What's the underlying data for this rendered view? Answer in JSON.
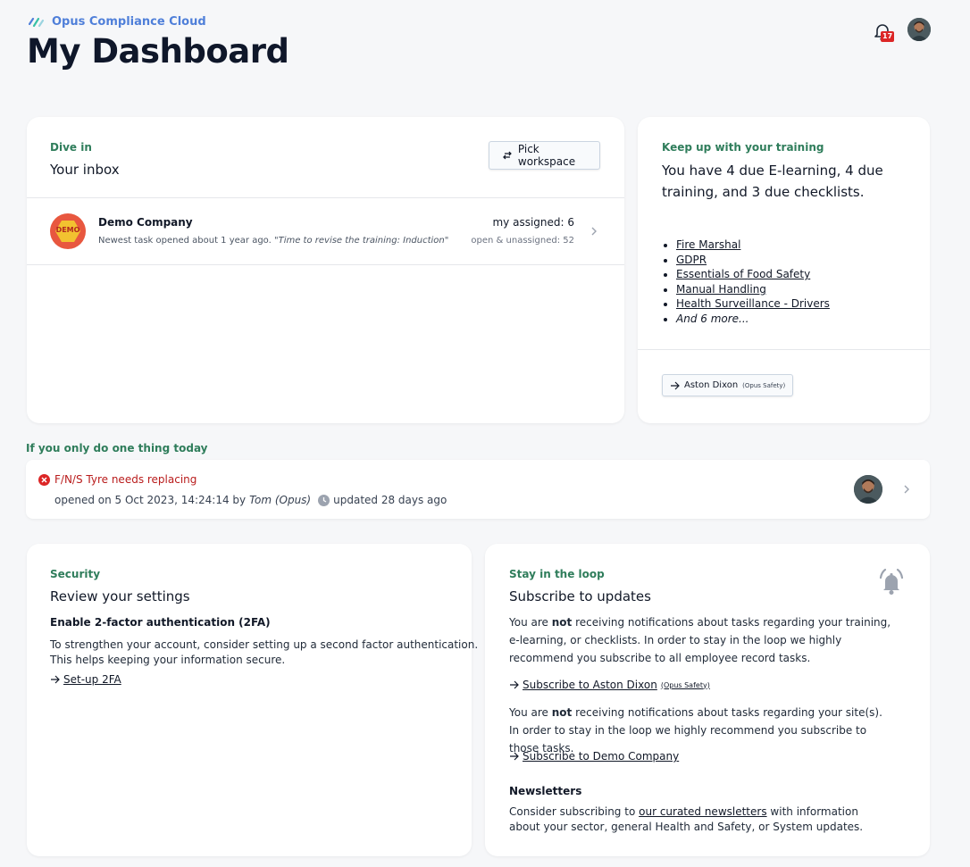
{
  "header": {
    "brand": "Opus Compliance Cloud",
    "title": "My Dashboard",
    "notification_count": "17"
  },
  "inbox": {
    "eyebrow": "Dive in",
    "title": "Your inbox",
    "pick_workspace_label": "Pick workspace",
    "company": {
      "logo_text": "DEMO",
      "name": "Demo Company",
      "newest": "Newest task opened about 1 year ago.",
      "quote": "\"Time to revise the training: Induction\"",
      "my_assigned": "my assigned: 6",
      "open_unassigned": "open & unassigned: 52"
    }
  },
  "training": {
    "eyebrow": "Keep up with your training",
    "title": "You have 4 due E-learning, 4 due training, and 3 due checklists.",
    "items": [
      "Fire Marshal",
      "GDPR",
      "Essentials of Food Safety",
      "Manual Handling",
      "Health Surveillance - Drivers"
    ],
    "more": "And 6 more...",
    "person_name": "Aston Dixon",
    "person_org": "(Opus Safety)"
  },
  "one_thing": {
    "eyebrow": "If you only do one thing today",
    "task_title": "F/N/S Tyre needs replacing",
    "opened_prefix": "opened on 5 Oct 2023, 14:24:14 by",
    "opened_by": "Tom (Opus)",
    "updated": "updated 28 days ago"
  },
  "security": {
    "eyebrow": "Security",
    "title": "Review your settings",
    "subheading": "Enable 2-factor authentication (2FA)",
    "desc_line1": "To strengthen your account, consider setting up a second factor authentication.",
    "desc_line2": "This helps keeping your information secure.",
    "setup_link": "Set-up 2FA"
  },
  "loop": {
    "eyebrow": "Stay in the loop",
    "title": "Subscribe to updates",
    "you_are": "You are",
    "not": "not",
    "p1_rest": "receiving notifications about tasks regarding your training, e-learning, or checklists. In order to stay in the loop we highly recommend you subscribe to all employee record tasks.",
    "sub1_label": "Subscribe to Aston Dixon",
    "sub1_org": "(Opus Safety)",
    "p2_rest": "receiving notifications about tasks regarding your site(s). In order to stay in the loop we highly recommend you subscribe to those tasks.",
    "sub2_label": "Subscribe to Demo Company",
    "newsletters_heading": "Newsletters",
    "news_prefix": "Consider subscribing to",
    "news_link": "our curated newsletters",
    "news_suffix": "with information about your sector, general Health and Safety, or System updates."
  },
  "colors": {
    "accent_green": "#2f7d5b",
    "brand_blue": "#4f7fd9",
    "danger": "#dc2626"
  }
}
